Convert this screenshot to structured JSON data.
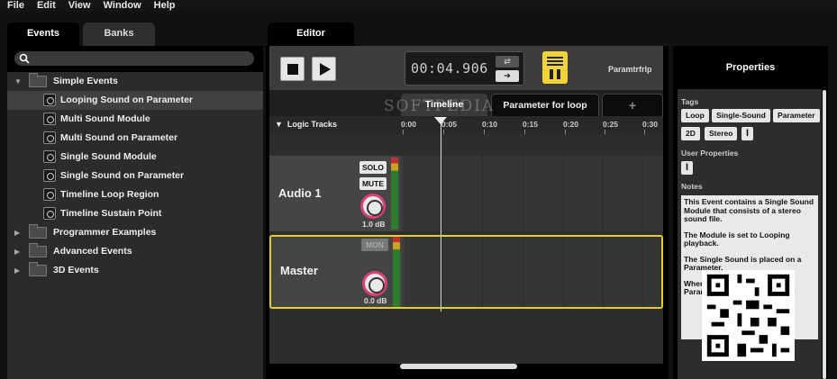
{
  "menu": [
    "File",
    "Edit",
    "View",
    "Window",
    "Help"
  ],
  "left_tabs": {
    "events": "Events",
    "banks": "Banks"
  },
  "tree": {
    "root": "Simple Events",
    "children": [
      "Looping Sound on Parameter",
      "Multi Sound Module",
      "Multi Sound on Parameter",
      "Single Sound Module",
      "Single Sound on Parameter",
      "Timeline Loop Region",
      "Timeline Sustain Point"
    ],
    "folders": [
      "Programmer Examples",
      "Advanced Events",
      "3D Events"
    ]
  },
  "editor": {
    "tab": "Editor",
    "timecode": "00:04.906",
    "param_name": "Paramtrfrlp",
    "tabs": [
      "Timeline",
      "Parameter for loop",
      "+"
    ],
    "logic_tracks": "Logic Tracks",
    "ticks": [
      "0:00",
      "0:05",
      "0:10",
      "0:15",
      "0:20",
      "0:25",
      "0:30"
    ],
    "tracks": [
      {
        "name": "Audio 1",
        "solo": "SOLO",
        "mute": "MUTE",
        "db": "1.0 dB"
      },
      {
        "name": "Master",
        "mon": "MON",
        "db": "0.0 dB"
      }
    ]
  },
  "properties": {
    "title": "Properties",
    "tags_label": "Tags",
    "tags": [
      "Loop",
      "Single-Sound",
      "Parameter",
      "2D",
      "Stereo"
    ],
    "user_properties_label": "User Properties",
    "notes_label": "Notes",
    "notes": [
      "This Event contains a Single Sound Module that consists of a stereo sound file.",
      "The Module is set to Looping playback.",
      "The Single Sound is placed on a Parameter.",
      "When a Module is placed on a Parameter the cursor does not"
    ]
  },
  "watermark": "SOFTPEDIA"
}
